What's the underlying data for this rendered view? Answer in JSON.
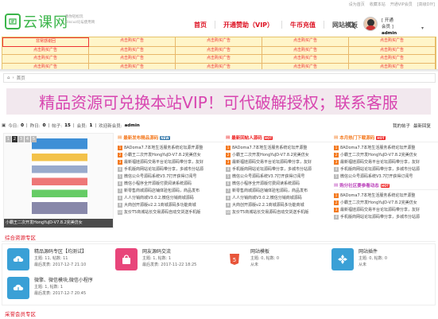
{
  "toplinks": [
    "设为首页",
    "收藏本站",
    "开通VIP会员",
    "[高级DIY]"
  ],
  "logo": {
    "text": "云课网",
    "subtitle": [
      "教你轻松玩",
      "Discuz论坛使用简"
    ]
  },
  "nav": {
    "items": [
      "首页",
      "开通赞助（VIP）",
      "牛币充值",
      "网站模板"
    ]
  },
  "user": {
    "line1": "[ 开通",
    "line2": "会员 ]",
    "name": "admin"
  },
  "ads": {
    "first": "非常感谢回",
    "cell": "点击购买广告"
  },
  "breadcrumb": {
    "home": "首页"
  },
  "banner": {
    "text": "精品资源可兑换本站VIP！可代破解授权；联系客服"
  },
  "stats": {
    "today_label": "今日:",
    "today_value": "0",
    "yesterday_label": "昨日:",
    "yesterday_value": "0",
    "posts_label": "帖子:",
    "posts_value": "15",
    "members_label": "会员:",
    "members_value": "1",
    "newest_label": "欢迎新会员:",
    "newest_value": "admin",
    "right_links": [
      "我的帖子",
      "最新回复"
    ]
  },
  "slideshow": {
    "dots": [
      "1",
      "2",
      "3",
      "4",
      "5"
    ],
    "caption": "小霸王二次开发HongYuJD-V7.8.2完美仿女"
  },
  "columns": [
    {
      "title": "最新发布精品源码",
      "badge": "NEW",
      "items": [
        "8ADoma7.7本地生活服务系统论坛源开源整",
        "小霸王二次开发HongYuJD-V7.8.2完美仿女",
        "最新福娃源码交易平台论坛源码带分享，友好",
        "手机版商网站论坛源码带分享，多城市分站源",
        "微信公众号源码系统V3.7打开获得订阅号",
        "微信小程序全开源版付费阅读系统源码",
        "新零售商城源码店铺体验包源码，商品发布",
        "人人分销商城V3.0.2,微信分销商城源码",
        "大商创开源版v2.2.1商城源码多功能商城",
        "友价T5商城站长交易源码自动交货送手机版"
      ]
    },
    {
      "title": "最新回帖人源码",
      "badge": "HOT",
      "items": [
        "8ADoma7.7本地生活服务系统论坛开源整",
        "小霸王二次开发HongYuJD-V7.8.2完美仿女",
        "最新福娃源码交易平台论坛源码带分享，友好",
        "手机版商网站论坛源码带分享，多城市分站源",
        "微信公众号源码系统V3.7打开获得订阅号",
        "微信小程序全开源版付费阅读系统源码",
        "新零售商城源码店铺体验包源码，商品发布",
        "人人分销商城V3.0.2,微信分销商城源码",
        "大商创开源版v2.2.1商城源码多功能商城",
        "友价T5商城站长交易源码自动交货送手机版"
      ]
    },
    {
      "title": "本月热门下载源码",
      "badge": "HOT",
      "items": [
        "8ADoma7.7本地生活服务系统论坛开源整",
        "小霸王二次开发HongYuJD-V7.8.2完美仿女",
        "最新福娃源码交易平台论坛源码带分享，友好",
        "手机版商网站论坛源码带分享，多城市分站源",
        "微信公众号源码系统V3.7打开获得订阅号"
      ],
      "title2": "购分社区要参看动态",
      "badge2": "HOT",
      "items2": [
        "8ADoma7.7本地生活服务系统论坛开源整",
        "小霸王二次开发HongYuJD-V7.8.2完美仿女",
        "最新福娃源码交易平台论坛源码带分享，友好",
        "手机版商网站论坛源码带分享，多城市分站源"
      ]
    }
  ],
  "section_title": "综合资源专区",
  "section_title2": "采誉会员专区",
  "forums": [
    {
      "name": "精品源码专区【均测试】",
      "counts": "主题: 11, 帖数: 11",
      "last": "最后发表: 2017-12-7 21:10",
      "color": "#3aa0d6"
    },
    {
      "name": "网友源码交流",
      "counts": "主题: 1, 帖数: 1",
      "last": "最后发表: 2017-11-22 18:25",
      "color": "#e8457a"
    },
    {
      "name": "网站模板",
      "counts": "主题: 0, 帖数: 0",
      "last": "从未",
      "color": "#e8553a"
    },
    {
      "name": "网站插件",
      "counts": "主题: 0, 帖数: 0",
      "last": "从未",
      "color": "#3aa0d6"
    },
    {
      "name": "微擎、微信模块,微信小程序",
      "counts": "主题: 1, 帖数: 1",
      "last": "最后发表: 2017-12-7 20:45",
      "color": "#3aa0d6"
    }
  ]
}
